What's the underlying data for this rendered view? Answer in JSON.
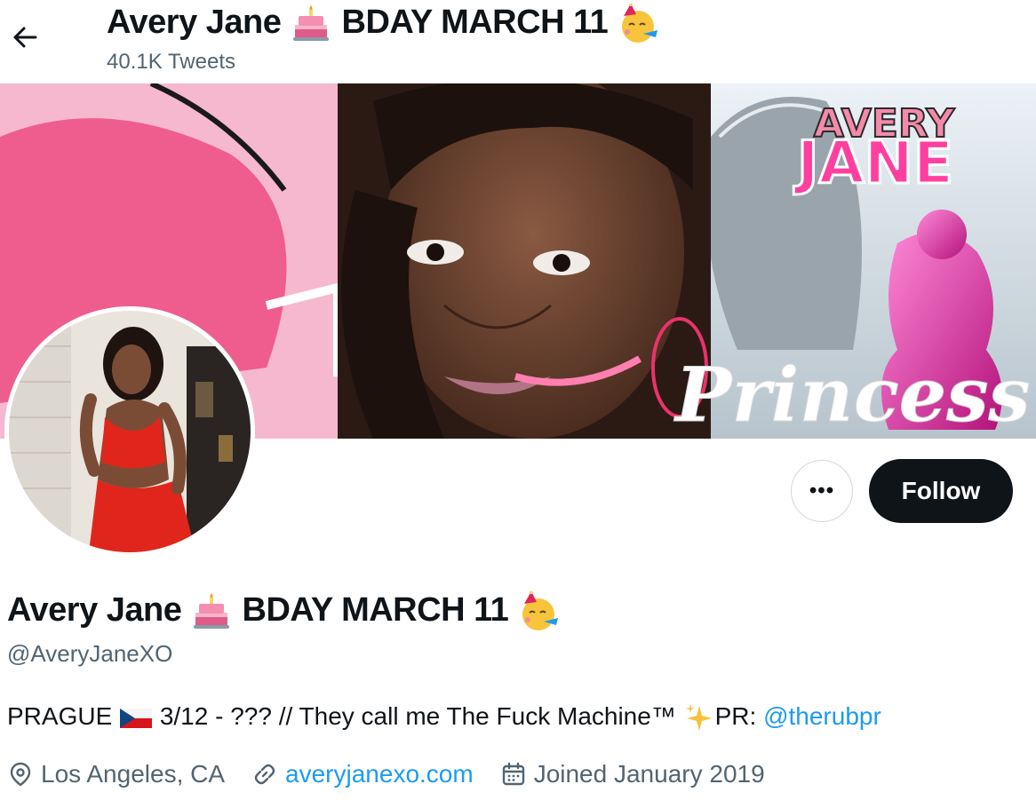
{
  "header": {
    "name": "Avery Jane",
    "name_suffix": "BDAY MARCH 11",
    "tweet_count": "40.1K Tweets"
  },
  "banner": {
    "overlay_line1": "AVERY",
    "overlay_line2": "JANE",
    "script_text": "Princess"
  },
  "actions": {
    "more_label": "•••",
    "follow_label": "Follow"
  },
  "profile": {
    "name": "Avery Jane",
    "name_suffix": "BDAY MARCH 11",
    "handle": "@AveryJaneXO",
    "bio_prefix": "PRAGUE",
    "bio_main": "3/12 - ??? // They call me The Fuck Machine™",
    "bio_pr": "PR:",
    "bio_link": "@therubpr",
    "location": "Los Angeles, CA",
    "website": "averyjanexo.com",
    "joined": "Joined January 2019"
  },
  "colors": {
    "accent": "#1d9bf0",
    "text_primary": "#0f1419",
    "text_secondary": "#536471",
    "follow_bg": "#0f1419",
    "banner_pink": "#e8336b"
  },
  "icons": [
    "back-arrow-icon",
    "birthday-cake-icon",
    "party-face-icon",
    "more-icon",
    "czech-flag-icon",
    "sparkles-icon",
    "location-pin-icon",
    "link-icon",
    "calendar-icon"
  ]
}
